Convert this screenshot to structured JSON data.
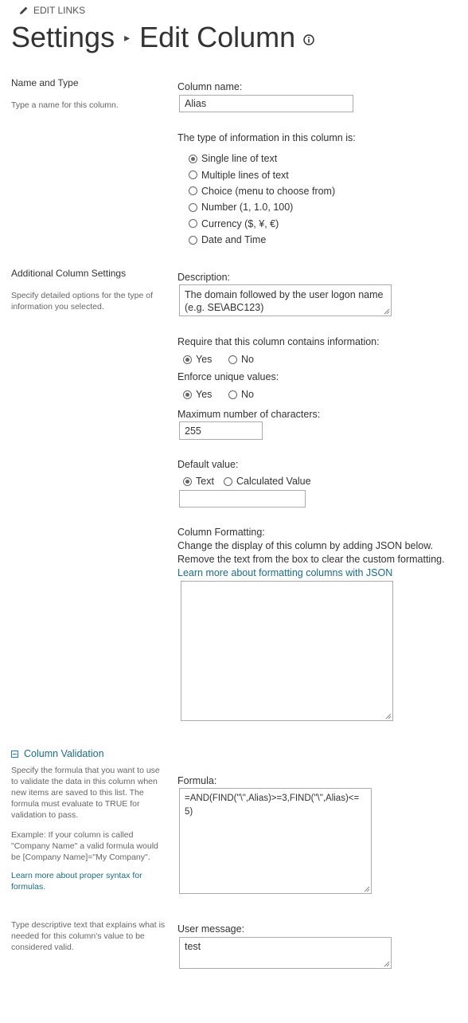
{
  "header": {
    "edit_links": "EDIT LINKS",
    "title_parent": "Settings",
    "title_child": "Edit Column"
  },
  "name_type": {
    "section_title": "Name and Type",
    "section_desc": "Type a name for this column.",
    "column_name_label": "Column name:",
    "column_name_value": "Alias",
    "type_label": "The type of information in this column is:",
    "types": [
      {
        "label": "Single line of text",
        "selected": true
      },
      {
        "label": "Multiple lines of text",
        "selected": false
      },
      {
        "label": "Choice (menu to choose from)",
        "selected": false
      },
      {
        "label": "Number (1, 1.0, 100)",
        "selected": false
      },
      {
        "label": "Currency ($, ¥, €)",
        "selected": false
      },
      {
        "label": "Date and Time",
        "selected": false
      }
    ]
  },
  "additional": {
    "section_title": "Additional Column Settings",
    "section_desc": "Specify detailed options for the type of information you selected.",
    "description_label": "Description:",
    "description_value": "The domain followed by the user logon name (e.g. SE\\ABC123)",
    "require_label": "Require that this column contains information:",
    "unique_label": "Enforce unique values:",
    "yes": "Yes",
    "no": "No",
    "max_chars_label": "Maximum number of characters:",
    "max_chars_value": "255",
    "default_label": "Default value:",
    "default_text": "Text",
    "default_calc": "Calculated Value",
    "default_value": "",
    "formatting_label": "Column Formatting:",
    "formatting_line1": "Change the display of this column by adding JSON below.",
    "formatting_line2": "Remove the text from the box to clear the custom formatting.",
    "formatting_link": "Learn more about formatting columns with JSON",
    "formatting_value": ""
  },
  "validation": {
    "section_title": "Column Validation",
    "desc1": "Specify the formula that you want to use to validate the data in this column when new items are saved to this list. The formula must evaluate to TRUE for validation to pass.",
    "desc2": "Example: If your column is called \"Company Name\" a valid formula would be [Company Name]=\"My Company\".",
    "desc_link": "Learn more about proper syntax for formulas.",
    "formula_label": "Formula:",
    "formula_value": "=AND(FIND(\"\\\",Alias)>=3,FIND(\"\\\",Alias)<=5)",
    "user_msg_desc": "Type descriptive text that explains what is needed for this column's value to be considered valid.",
    "user_msg_label": "User message:",
    "user_msg_value": "test"
  },
  "colors": {
    "link": "#1e6b80",
    "text": "#333333",
    "muted": "#666666"
  }
}
